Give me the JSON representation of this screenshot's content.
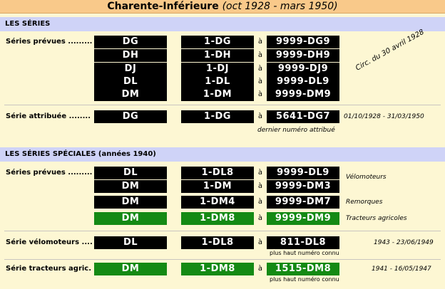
{
  "header": {
    "title": "Charente-Inférieure",
    "subtitle": "(oct 1928 - mars 1950)"
  },
  "sections": {
    "series": "LES SÉRIES",
    "special": "LES SÉRIES SPÉCIALES (années 1940)"
  },
  "labels": {
    "prevues": "Séries prévues .........",
    "attribuee": "Série attribuée ........",
    "prevues2": "Séries prévues .........",
    "velo": "Série vélomoteurs ....",
    "tract": "Série tracteurs agric."
  },
  "a": "à",
  "rows1": [
    {
      "s": "DG",
      "from": "1-DG",
      "to": "9999-DG9"
    },
    {
      "s": "DH",
      "from": "1-DH",
      "to": "9999-DH9"
    },
    {
      "s": "DJ",
      "from": "1-DJ",
      "to": "9999-DJ9"
    },
    {
      "s": "DL",
      "from": "1-DL",
      "to": "9999-DL9"
    },
    {
      "s": "DM",
      "from": "1-DM",
      "to": "9999-DM9"
    }
  ],
  "circ": "Circ. du 30 avril 1928",
  "attrib": {
    "s": "DG",
    "from": "1-DG",
    "to": "5641-DG7",
    "dates": "01/10/1928 - 31/03/1950",
    "note": "dernier numéro attribué"
  },
  "rows2": [
    {
      "s": "DL",
      "from": "1-DL8",
      "to": "9999-DL9",
      "note": "Vélomoteurs"
    },
    {
      "s": "DM",
      "from": "1-DM",
      "to": "9999-DM3",
      "note": ""
    },
    {
      "s": "DM",
      "from": "1-DM4",
      "to": "9999-DM7",
      "note": "Remorques"
    },
    {
      "s": "DM",
      "from": "1-DM8",
      "to": "9999-DM9",
      "note": "Tracteurs agricoles"
    }
  ],
  "velo": {
    "s": "DL",
    "from": "1-DL8",
    "to": "811-DL8",
    "dates": "1943 - 23/06/1949",
    "note": "plus haut numéro connu"
  },
  "tract": {
    "s": "DM",
    "from": "1-DM8",
    "to": "1515-DM8",
    "dates": "1941 - 16/05/1947",
    "note": "plus haut numéro connu"
  },
  "colors": {
    "plate": "#000000",
    "green": "#148a14",
    "band": "#cfd3f7",
    "title": "#f9c98a",
    "bg": "#fdf7d3"
  }
}
